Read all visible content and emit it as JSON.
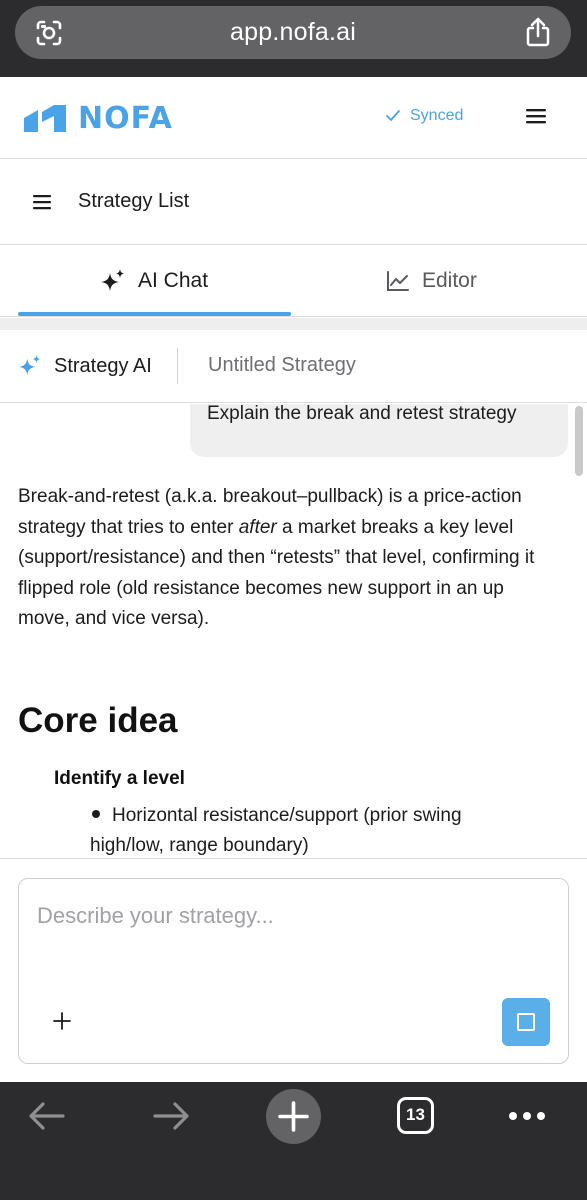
{
  "browser": {
    "url": "app.nofa.ai",
    "tab_count": "13"
  },
  "header": {
    "logo_text": "NOFA",
    "sync_status": "Synced",
    "brand_color": "#4aa3e6"
  },
  "strategy_list": {
    "label": "Strategy List"
  },
  "tabs": [
    {
      "label": "AI Chat",
      "icon": "sparkle-icon",
      "active": true
    },
    {
      "label": "Editor",
      "icon": "chart-line-icon",
      "active": false
    }
  ],
  "strategy_bar": {
    "assistant_label": "Strategy AI",
    "strategy_name": "Untitled Strategy"
  },
  "chat": {
    "user_message": "Explain the break and retest strategy",
    "response": {
      "intro_before": "Break-and-retest (a.k.a. breakout–pullback) is a price-action strategy that tries to enter ",
      "intro_emphasis": "after",
      "intro_after": " a market breaks a key level (support/resistance) and then “retests” that level, confirming it flipped role (old resistance becomes new support in an up move, and vice versa).",
      "heading": "Core idea",
      "subheading": "Identify a level",
      "bullet_line1": "Horizontal resistance/support (prior swing",
      "bullet_line2": "high/low, range boundary)"
    }
  },
  "composer": {
    "placeholder": "Describe your strategy...",
    "value": ""
  }
}
